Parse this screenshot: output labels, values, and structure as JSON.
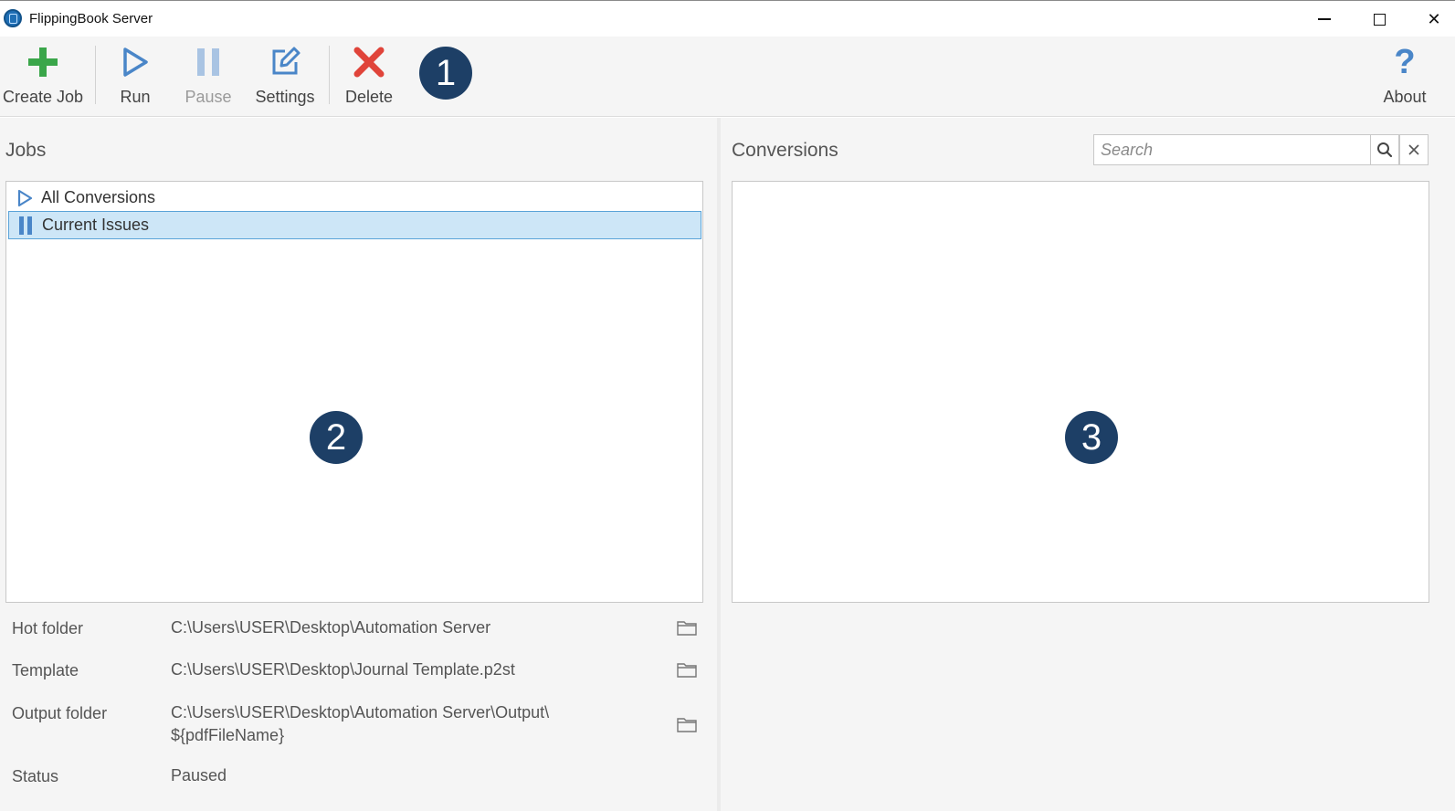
{
  "window": {
    "title": "FlippingBook Server",
    "min_glyph": "minimize-icon",
    "max_glyph": "maximize-icon",
    "close_glyph": "✕"
  },
  "toolbar": {
    "create_job": "Create Job",
    "run": "Run",
    "pause": "Pause",
    "settings": "Settings",
    "delete": "Delete",
    "about": "About",
    "pause_disabled": true
  },
  "badges": {
    "one": "1",
    "two": "2",
    "three": "3"
  },
  "jobs": {
    "title": "Jobs",
    "items": [
      {
        "label": "All Conversions",
        "icon": "play-icon",
        "selected": false
      },
      {
        "label": "Current Issues",
        "icon": "pause-icon",
        "selected": true
      }
    ]
  },
  "properties": {
    "hot_folder_label": "Hot folder",
    "hot_folder_value": "C:\\Users\\USER\\Desktop\\Automation Server",
    "template_label": "Template",
    "template_value": "C:\\Users\\USER\\Desktop\\Journal Template.p2st",
    "output_folder_label": "Output folder",
    "output_folder_value_line1": "C:\\Users\\USER\\Desktop\\Automation Server\\Output\\",
    "output_folder_value_line2": "${pdfFileName}",
    "status_label": "Status",
    "status_value": "Paused"
  },
  "conversions": {
    "title": "Conversions",
    "search_placeholder": "Search",
    "search_value": ""
  },
  "colors": {
    "accent_blue": "#4a86c8",
    "create_green": "#3aa64a",
    "delete_red": "#e0443a",
    "badge_navy": "#1d3f66",
    "selection_bg": "#cde6f7"
  }
}
